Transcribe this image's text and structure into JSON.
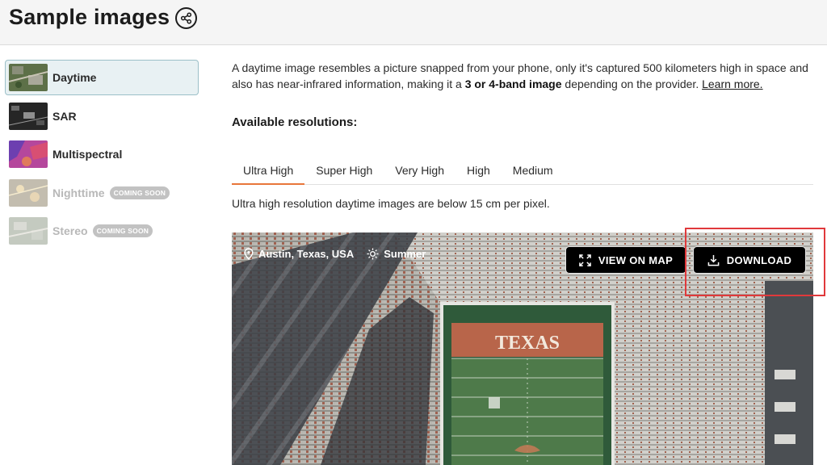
{
  "header": {
    "title": "Sample images",
    "share_icon": "share-icon"
  },
  "sidebar": {
    "items": [
      {
        "label": "Daytime",
        "active": true,
        "disabled": false,
        "badge": "",
        "thumb_color": "#5b7a4a"
      },
      {
        "label": "SAR",
        "active": false,
        "disabled": false,
        "badge": "",
        "thumb_color": "#2a2a2a"
      },
      {
        "label": "Multispectral",
        "active": false,
        "disabled": false,
        "badge": "",
        "thumb_color": "#b44aa0"
      },
      {
        "label": "Nighttime",
        "active": false,
        "disabled": true,
        "badge": "COMING SOON",
        "thumb_color": "#8a7f5c"
      },
      {
        "label": "Stereo",
        "active": false,
        "disabled": true,
        "badge": "COMING SOON",
        "thumb_color": "#7d8b78"
      }
    ]
  },
  "main": {
    "desc_part1": "A daytime image resembles a picture snapped from your phone, only it's captured 500 kilometers high in space and also has near-infrared information, making it a ",
    "desc_bold": "3 or 4-band image",
    "desc_part2": " depending on the provider. ",
    "learn_more": "Learn more.",
    "resolutions_heading": "Available resolutions:",
    "tabs": [
      {
        "label": "Ultra High",
        "active": true
      },
      {
        "label": "Super High",
        "active": false
      },
      {
        "label": "Very High",
        "active": false
      },
      {
        "label": "High",
        "active": false
      },
      {
        "label": "Medium",
        "active": false
      }
    ],
    "resolution_note": "Ultra high resolution daytime images are below 15 cm per pixel."
  },
  "image": {
    "location": "Austin, Texas, USA",
    "season": "Summer",
    "field_text": "TEXAS",
    "view_map_label": "VIEW ON MAP",
    "download_label": "DOWNLOAD",
    "location_icon": "map-pin-icon",
    "season_icon": "sun-icon",
    "view_map_icon": "expand-icon",
    "download_icon": "download-icon"
  },
  "colors": {
    "accent": "#e8763a",
    "active_bg": "#e8f1f3",
    "highlight": "#e0393b",
    "field": "#4e7a4a",
    "endzone": "#b8654a"
  }
}
